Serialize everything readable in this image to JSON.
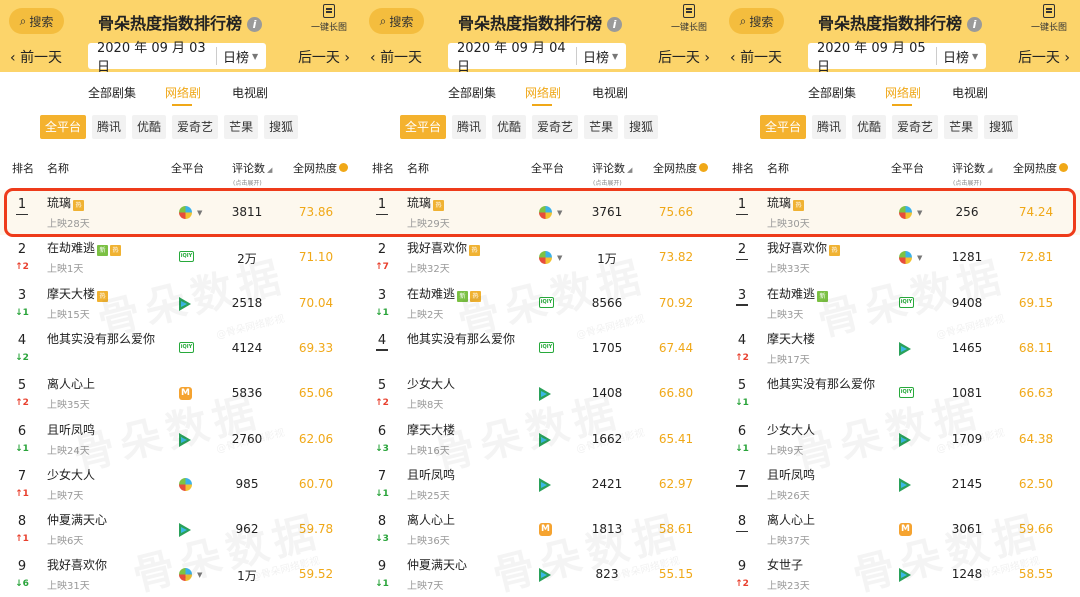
{
  "app": {
    "title": "骨朵热度指数排行榜",
    "search_label": "搜索",
    "long_image_label": "一键长图",
    "prev_label": "前一天",
    "next_label": "后一天",
    "type_label": "日榜",
    "categories": [
      "全部剧集",
      "网络剧",
      "电视剧"
    ],
    "platforms": [
      "全平台",
      "腾讯",
      "优酷",
      "爱奇艺",
      "芒果",
      "搜狐"
    ],
    "columns": {
      "rank": "排名",
      "name": "名称",
      "platform": "全平台",
      "comments": "评论数",
      "comments_sub": "(点击展开)",
      "heat": "全网热度"
    },
    "watermark": "骨朵数据",
    "watermark_sub": "@骨朵网络影视",
    "colors": {
      "header": "#fcd46a",
      "accent": "#f0a818",
      "up": "#e8402e",
      "down": "#2aa43b",
      "highlight": "#ee3b1a"
    }
  },
  "panels": [
    {
      "date": "2020 年 09 月 03 日",
      "rows": [
        {
          "rank": "1",
          "change": "",
          "dir": "",
          "box": true,
          "name": "琉璃",
          "tags": [
            "hot"
          ],
          "sub": "上映28天",
          "platform": "multi",
          "caret": true,
          "comments": "3811",
          "heat": "73.86"
        },
        {
          "rank": "2",
          "change": "2",
          "dir": "up",
          "box": false,
          "name": "在劫难逃",
          "tags": [
            "new",
            "hot"
          ],
          "sub": "上映1天",
          "platform": "iqiyi",
          "caret": false,
          "comments": "2万",
          "heat": "71.10"
        },
        {
          "rank": "3",
          "change": "1",
          "dir": "down",
          "box": false,
          "name": "摩天大楼",
          "tags": [
            "hot"
          ],
          "sub": "上映15天",
          "platform": "youku",
          "caret": false,
          "comments": "2518",
          "heat": "70.04"
        },
        {
          "rank": "4",
          "change": "2",
          "dir": "down",
          "box": false,
          "name": "他其实没有那么爱你",
          "tags": [],
          "sub": "",
          "platform": "iqiyi",
          "caret": false,
          "comments": "4124",
          "heat": "69.33"
        },
        {
          "rank": "5",
          "change": "2",
          "dir": "up",
          "box": false,
          "name": "离人心上",
          "tags": [],
          "sub": "上映35天",
          "platform": "mango",
          "caret": false,
          "comments": "5836",
          "heat": "65.06"
        },
        {
          "rank": "6",
          "change": "1",
          "dir": "down",
          "box": false,
          "name": "且听凤鸣",
          "tags": [],
          "sub": "上映24天",
          "platform": "youku",
          "caret": false,
          "comments": "2760",
          "heat": "62.06"
        },
        {
          "rank": "7",
          "change": "1",
          "dir": "up",
          "box": false,
          "name": "少女大人",
          "tags": [],
          "sub": "上映7天",
          "platform": "multi",
          "caret": false,
          "comments": "985",
          "heat": "60.70"
        },
        {
          "rank": "8",
          "change": "1",
          "dir": "up",
          "box": false,
          "name": "仲夏满天心",
          "tags": [],
          "sub": "上映6天",
          "platform": "youku",
          "caret": false,
          "comments": "962",
          "heat": "59.78"
        },
        {
          "rank": "9",
          "change": "6",
          "dir": "down",
          "box": false,
          "name": "我好喜欢你",
          "tags": [],
          "sub": "上映31天",
          "platform": "multi",
          "caret": true,
          "comments": "1万",
          "heat": "59.52"
        }
      ]
    },
    {
      "date": "2020 年 09 月 04 日",
      "rows": [
        {
          "rank": "1",
          "change": "",
          "dir": "",
          "box": true,
          "name": "琉璃",
          "tags": [
            "hot"
          ],
          "sub": "上映29天",
          "platform": "multi",
          "caret": true,
          "comments": "3761",
          "heat": "75.66"
        },
        {
          "rank": "2",
          "change": "7",
          "dir": "up",
          "box": false,
          "name": "我好喜欢你",
          "tags": [
            "hot"
          ],
          "sub": "上映32天",
          "platform": "multi",
          "caret": true,
          "comments": "1万",
          "heat": "73.82"
        },
        {
          "rank": "3",
          "change": "1",
          "dir": "down",
          "box": false,
          "name": "在劫难逃",
          "tags": [
            "new",
            "hot"
          ],
          "sub": "上映2天",
          "platform": "iqiyi",
          "caret": false,
          "comments": "8566",
          "heat": "70.92"
        },
        {
          "rank": "4",
          "change": "",
          "dir": "",
          "box": true,
          "name": "他其实没有那么爱你",
          "tags": [],
          "sub": "",
          "platform": "iqiyi",
          "caret": false,
          "comments": "1705",
          "heat": "67.44"
        },
        {
          "rank": "5",
          "change": "2",
          "dir": "up",
          "box": false,
          "name": "少女大人",
          "tags": [],
          "sub": "上映8天",
          "platform": "youku",
          "caret": false,
          "comments": "1408",
          "heat": "66.80"
        },
        {
          "rank": "6",
          "change": "3",
          "dir": "down",
          "box": false,
          "name": "摩天大楼",
          "tags": [],
          "sub": "上映16天",
          "platform": "youku",
          "caret": false,
          "comments": "1662",
          "heat": "65.41"
        },
        {
          "rank": "7",
          "change": "1",
          "dir": "down",
          "box": false,
          "name": "且听凤鸣",
          "tags": [],
          "sub": "上映25天",
          "platform": "youku",
          "caret": false,
          "comments": "2421",
          "heat": "62.97"
        },
        {
          "rank": "8",
          "change": "3",
          "dir": "down",
          "box": false,
          "name": "离人心上",
          "tags": [],
          "sub": "上映36天",
          "platform": "mango",
          "caret": false,
          "comments": "1813",
          "heat": "58.61"
        },
        {
          "rank": "9",
          "change": "1",
          "dir": "down",
          "box": false,
          "name": "仲夏满天心",
          "tags": [],
          "sub": "上映7天",
          "platform": "youku",
          "caret": false,
          "comments": "823",
          "heat": "55.15"
        }
      ]
    },
    {
      "date": "2020 年 09 月 05 日",
      "rows": [
        {
          "rank": "1",
          "change": "",
          "dir": "",
          "box": true,
          "name": "琉璃",
          "tags": [
            "hot"
          ],
          "sub": "上映30天",
          "platform": "multi",
          "caret": true,
          "comments": "256",
          "heat": "74.24"
        },
        {
          "rank": "2",
          "change": "",
          "dir": "",
          "box": true,
          "name": "我好喜欢你",
          "tags": [
            "hot"
          ],
          "sub": "上映33天",
          "platform": "multi",
          "caret": true,
          "comments": "1281",
          "heat": "72.81"
        },
        {
          "rank": "3",
          "change": "",
          "dir": "",
          "box": true,
          "name": "在劫难逃",
          "tags": [
            "new"
          ],
          "sub": "上映3天",
          "platform": "iqiyi",
          "caret": false,
          "comments": "9408",
          "heat": "69.15"
        },
        {
          "rank": "4",
          "change": "2",
          "dir": "up",
          "box": false,
          "name": "摩天大楼",
          "tags": [],
          "sub": "上映17天",
          "platform": "youku",
          "caret": false,
          "comments": "1465",
          "heat": "68.11"
        },
        {
          "rank": "5",
          "change": "1",
          "dir": "down",
          "box": false,
          "name": "他其实没有那么爱你",
          "tags": [],
          "sub": "",
          "platform": "iqiyi",
          "caret": false,
          "comments": "1081",
          "heat": "66.63"
        },
        {
          "rank": "6",
          "change": "1",
          "dir": "down",
          "box": false,
          "name": "少女大人",
          "tags": [],
          "sub": "上映9天",
          "platform": "youku",
          "caret": false,
          "comments": "1709",
          "heat": "64.38"
        },
        {
          "rank": "7",
          "change": "",
          "dir": "",
          "box": true,
          "name": "且听凤鸣",
          "tags": [],
          "sub": "上映26天",
          "platform": "youku",
          "caret": false,
          "comments": "2145",
          "heat": "62.50"
        },
        {
          "rank": "8",
          "change": "",
          "dir": "",
          "box": true,
          "name": "离人心上",
          "tags": [],
          "sub": "上映37天",
          "platform": "mango",
          "caret": false,
          "comments": "3061",
          "heat": "59.66"
        },
        {
          "rank": "9",
          "change": "2",
          "dir": "up",
          "box": false,
          "name": "女世子",
          "tags": [],
          "sub": "上映23天",
          "platform": "youku",
          "caret": false,
          "comments": "1248",
          "heat": "58.55"
        }
      ]
    }
  ]
}
